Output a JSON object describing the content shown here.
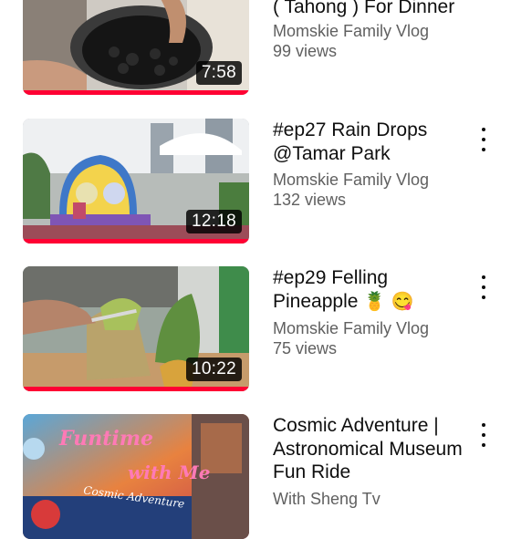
{
  "videos": [
    {
      "title_line": "( Tahong ) For Dinner",
      "channel": "Momskie Family Vlog",
      "views": "99 views",
      "duration": "7:58",
      "watched_fraction": 1.0,
      "thumb_icon": "cooking-bowl"
    },
    {
      "title": "#ep27 Rain Drops @Tamar Park",
      "channel": "Momskie Family Vlog",
      "views": "132 views",
      "duration": "12:18",
      "watched_fraction": 1.0,
      "thumb_icon": "park-playground"
    },
    {
      "title": "#ep29 Felling Pineapple",
      "title_emojis": "🍍 😋",
      "channel": "Momskie Family Vlog",
      "views": "75 views",
      "duration": "10:22",
      "watched_fraction": 1.0,
      "thumb_icon": "pineapple-cutting"
    },
    {
      "title": "Cosmic Adventure | Astronomical Museum Fun Ride",
      "channel": "With Sheng Tv",
      "thumb_overlay_line1": "Funtime",
      "thumb_overlay_line2": "with Me",
      "thumb_overlay_line3": "Cosmic Adventure",
      "thumb_icon": "space-museum"
    }
  ],
  "colors": {
    "progress": "#ff0033",
    "secondary_text": "#606060",
    "primary_text": "#0f0f0f"
  },
  "menu_icon": "more-vert-icon"
}
